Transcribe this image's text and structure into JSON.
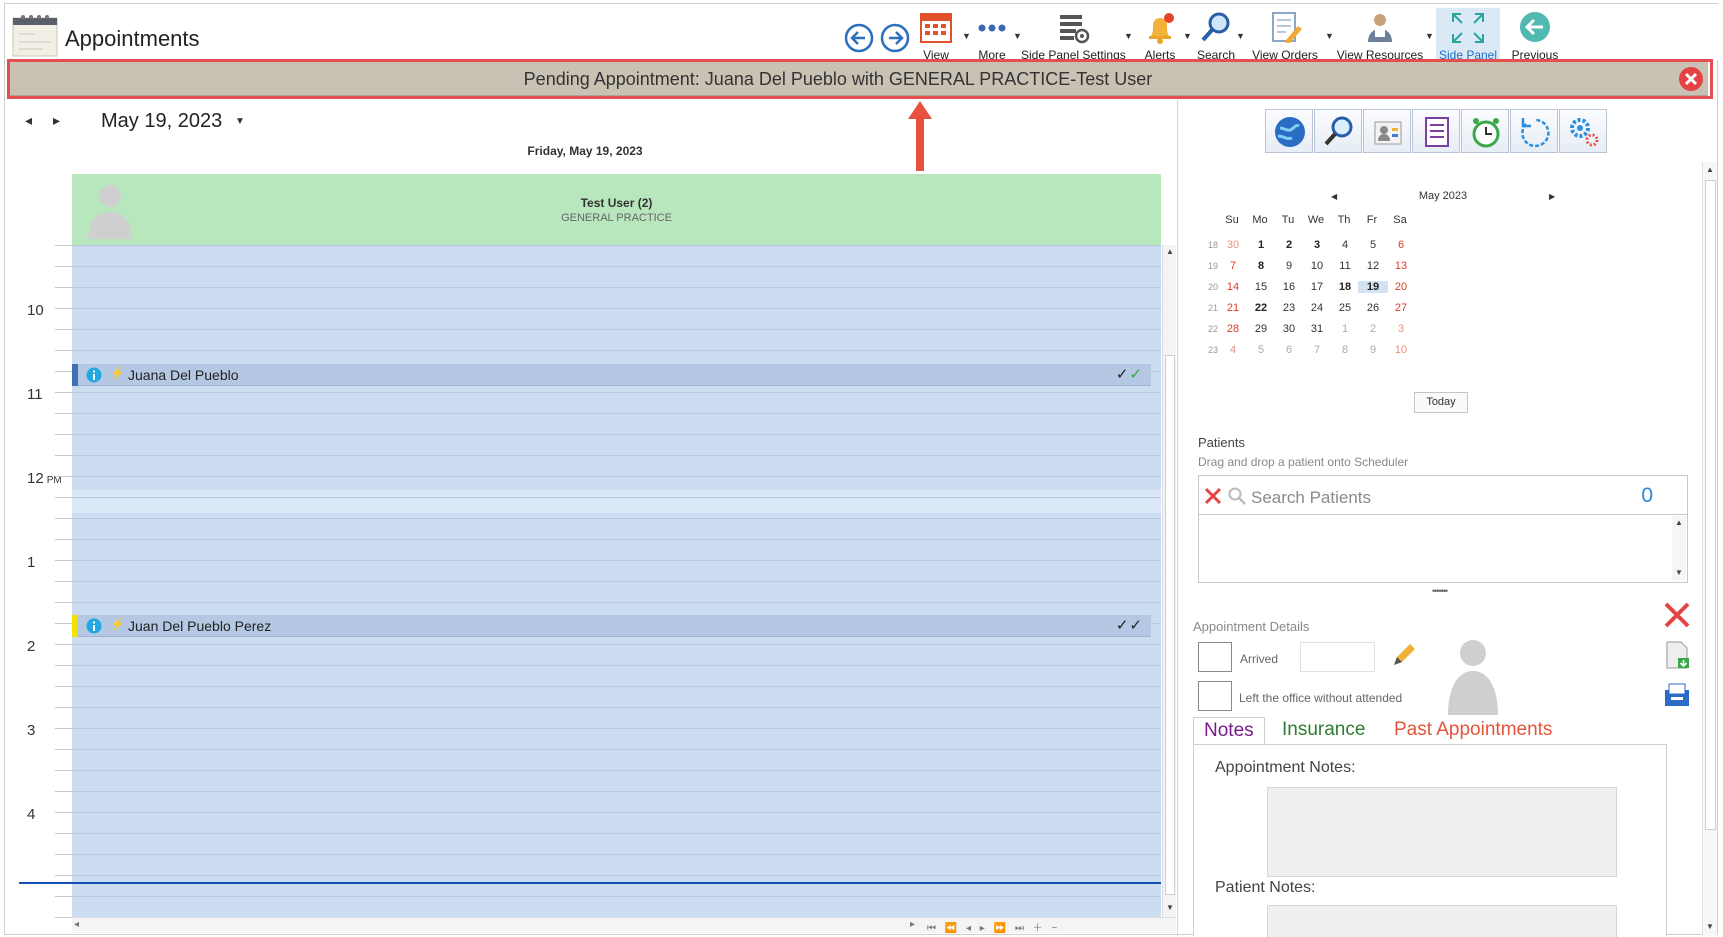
{
  "app": {
    "title": "Appointments"
  },
  "toolbar": {
    "items": [
      {
        "label": "View",
        "icon": "calendar-grid-icon"
      },
      {
        "label": "More",
        "icon": "more-dots-icon"
      },
      {
        "label": "Side Panel Settings",
        "icon": "panel-settings-icon"
      },
      {
        "label": "Alerts",
        "icon": "bell-icon"
      },
      {
        "label": "Search",
        "icon": "search-icon"
      },
      {
        "label": "View Orders",
        "icon": "orders-icon"
      },
      {
        "label": "View Resources",
        "icon": "resources-icon"
      },
      {
        "label": "Side Panel",
        "icon": "expand-icon",
        "active": true
      },
      {
        "label": "Previous",
        "icon": "back-arrow-icon"
      }
    ]
  },
  "banner": {
    "text": "Pending Appointment: Juana Del Pueblo with GENERAL PRACTICE-Test User"
  },
  "scheduler": {
    "date": "May 19, 2023",
    "day_header": "Friday, May 19, 2023",
    "resource": {
      "name": "Test User (2)",
      "department": "GENERAL PRACTICE"
    },
    "hours": [
      "10",
      "11",
      "12",
      "1",
      "2",
      "3",
      "4"
    ],
    "noon_suffix": "PM",
    "appointments": [
      {
        "name": "Juana Del Pueblo",
        "status_color": "#3f6fb5",
        "checks": "✓✓"
      },
      {
        "name": "Juan Del Pueblo Perez",
        "status_color": "#f2e200",
        "checks": "✓✓"
      }
    ]
  },
  "mini_calendar": {
    "title": "May 2023",
    "weekdays": [
      "Su",
      "Mo",
      "Tu",
      "We",
      "Th",
      "Fr",
      "Sa"
    ],
    "weeks": [
      {
        "wk": "18",
        "days": [
          "30",
          "1",
          "2",
          "3",
          "4",
          "5",
          "6"
        ]
      },
      {
        "wk": "19",
        "days": [
          "7",
          "8",
          "9",
          "10",
          "11",
          "12",
          "13"
        ]
      },
      {
        "wk": "20",
        "days": [
          "14",
          "15",
          "16",
          "17",
          "18",
          "19",
          "20"
        ]
      },
      {
        "wk": "21",
        "days": [
          "21",
          "22",
          "23",
          "24",
          "25",
          "26",
          "27"
        ]
      },
      {
        "wk": "22",
        "days": [
          "28",
          "29",
          "30",
          "31",
          "1",
          "2",
          "3"
        ]
      },
      {
        "wk": "23",
        "days": [
          "4",
          "5",
          "6",
          "7",
          "8",
          "9",
          "10"
        ]
      }
    ],
    "selected": "19",
    "today_label": "Today"
  },
  "patients": {
    "label": "Patients",
    "hint": "Drag and drop a patient onto Scheduler",
    "search_placeholder": "Search Patients",
    "count": "0"
  },
  "appointment_details": {
    "label": "Appointment Details",
    "arrived_label": "Arrived",
    "left_label": "Left the office without attended"
  },
  "tabs": {
    "notes": "Notes",
    "insurance": "Insurance",
    "past": "Past Appointments"
  },
  "notes": {
    "appointment_label": "Appointment Notes:",
    "patient_label": "Patient Notes:"
  }
}
